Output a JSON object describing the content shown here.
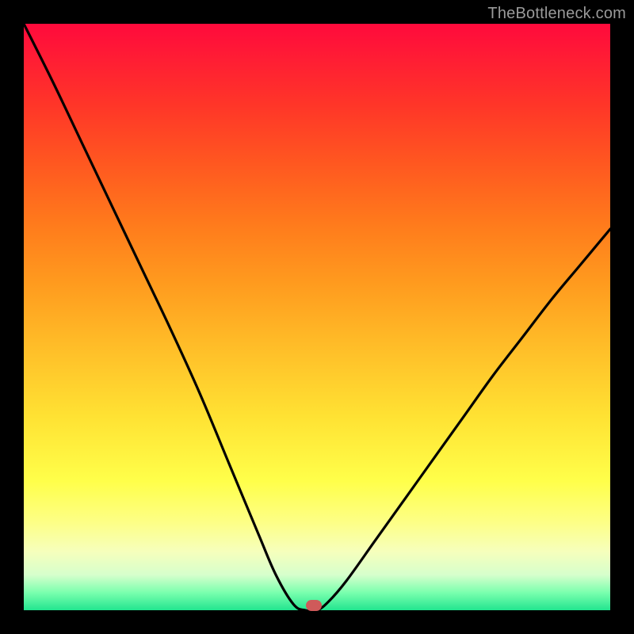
{
  "watermark": "TheBottleneck.com",
  "marker": {
    "x_pct": 49.5,
    "y_pct": 99.2,
    "color": "#cf5a5a"
  },
  "chart_data": {
    "type": "line",
    "title": "",
    "xlabel": "",
    "ylabel": "",
    "xlim": [
      0,
      100
    ],
    "ylim": [
      0,
      100
    ],
    "grid": false,
    "legend": false,
    "series": [
      {
        "name": "bottleneck-curve",
        "x": [
          0,
          5,
          10,
          15,
          20,
          25,
          30,
          35,
          40,
          43,
          46,
          48,
          50,
          52,
          55,
          60,
          65,
          70,
          75,
          80,
          85,
          90,
          95,
          100
        ],
        "values": [
          100,
          90,
          79.5,
          69,
          58.5,
          48,
          37,
          25,
          13,
          6,
          1,
          0,
          0,
          1.5,
          5,
          12,
          19,
          26,
          33,
          40,
          46.5,
          53,
          59,
          65
        ]
      }
    ],
    "annotations": [
      {
        "type": "marker",
        "x": 49.5,
        "y": 0.8,
        "label": "optimal-point"
      }
    ],
    "background_gradient": {
      "direction": "top-to-bottom",
      "stops": [
        {
          "pct": 0,
          "color": "#ff0a3c"
        },
        {
          "pct": 24,
          "color": "#ff5820"
        },
        {
          "pct": 55,
          "color": "#ffbd28"
        },
        {
          "pct": 78,
          "color": "#ffff4a"
        },
        {
          "pct": 100,
          "color": "#22e58f"
        }
      ]
    }
  }
}
